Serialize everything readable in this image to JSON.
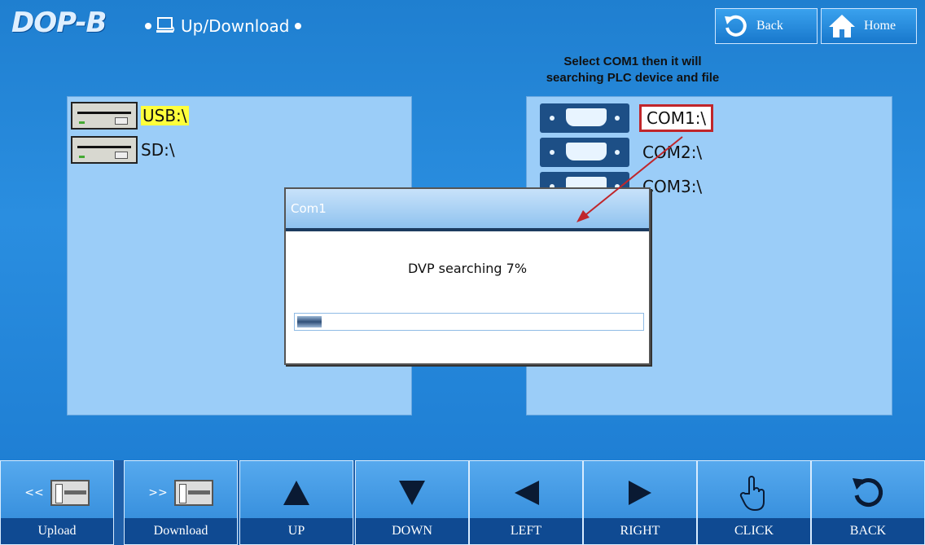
{
  "header": {
    "logo_text": "DOP-B",
    "title": "Up/Download",
    "back_label": "Back",
    "home_label": "Home"
  },
  "hint": {
    "line1": "Select COM1 then it will",
    "line2": "searching PLC device and file"
  },
  "left_panel": {
    "items": [
      {
        "label": "USB:\\",
        "highlighted": true
      },
      {
        "label": "SD:\\",
        "highlighted": false
      }
    ]
  },
  "right_panel": {
    "items": [
      {
        "label": "COM1:\\",
        "selected": true
      },
      {
        "label": "COM2:\\",
        "selected": false
      },
      {
        "label": "COM3:\\",
        "selected": false
      }
    ]
  },
  "dialog": {
    "title": "Com1",
    "message": "DVP searching 7%",
    "progress": 0.07
  },
  "toolbar": {
    "buttons": [
      {
        "label": "Upload",
        "prefix": "<<",
        "icon": "device-icon"
      },
      {
        "label": "Download",
        "prefix": ">>",
        "icon": "device-icon"
      },
      {
        "label": "UP",
        "icon": "triangle-up-icon"
      },
      {
        "label": "DOWN",
        "icon": "triangle-down-icon"
      },
      {
        "label": "LEFT",
        "icon": "triangle-left-icon"
      },
      {
        "label": "RIGHT",
        "icon": "triangle-right-icon"
      },
      {
        "label": "CLICK",
        "icon": "hand-pointer-icon"
      },
      {
        "label": "BACK",
        "icon": "undo-icon"
      }
    ]
  },
  "colors": {
    "background": "#1f7fd0",
    "panel": "#9bcdf8",
    "highlight": "#ffff3c",
    "annotation_red": "#c0262b"
  }
}
